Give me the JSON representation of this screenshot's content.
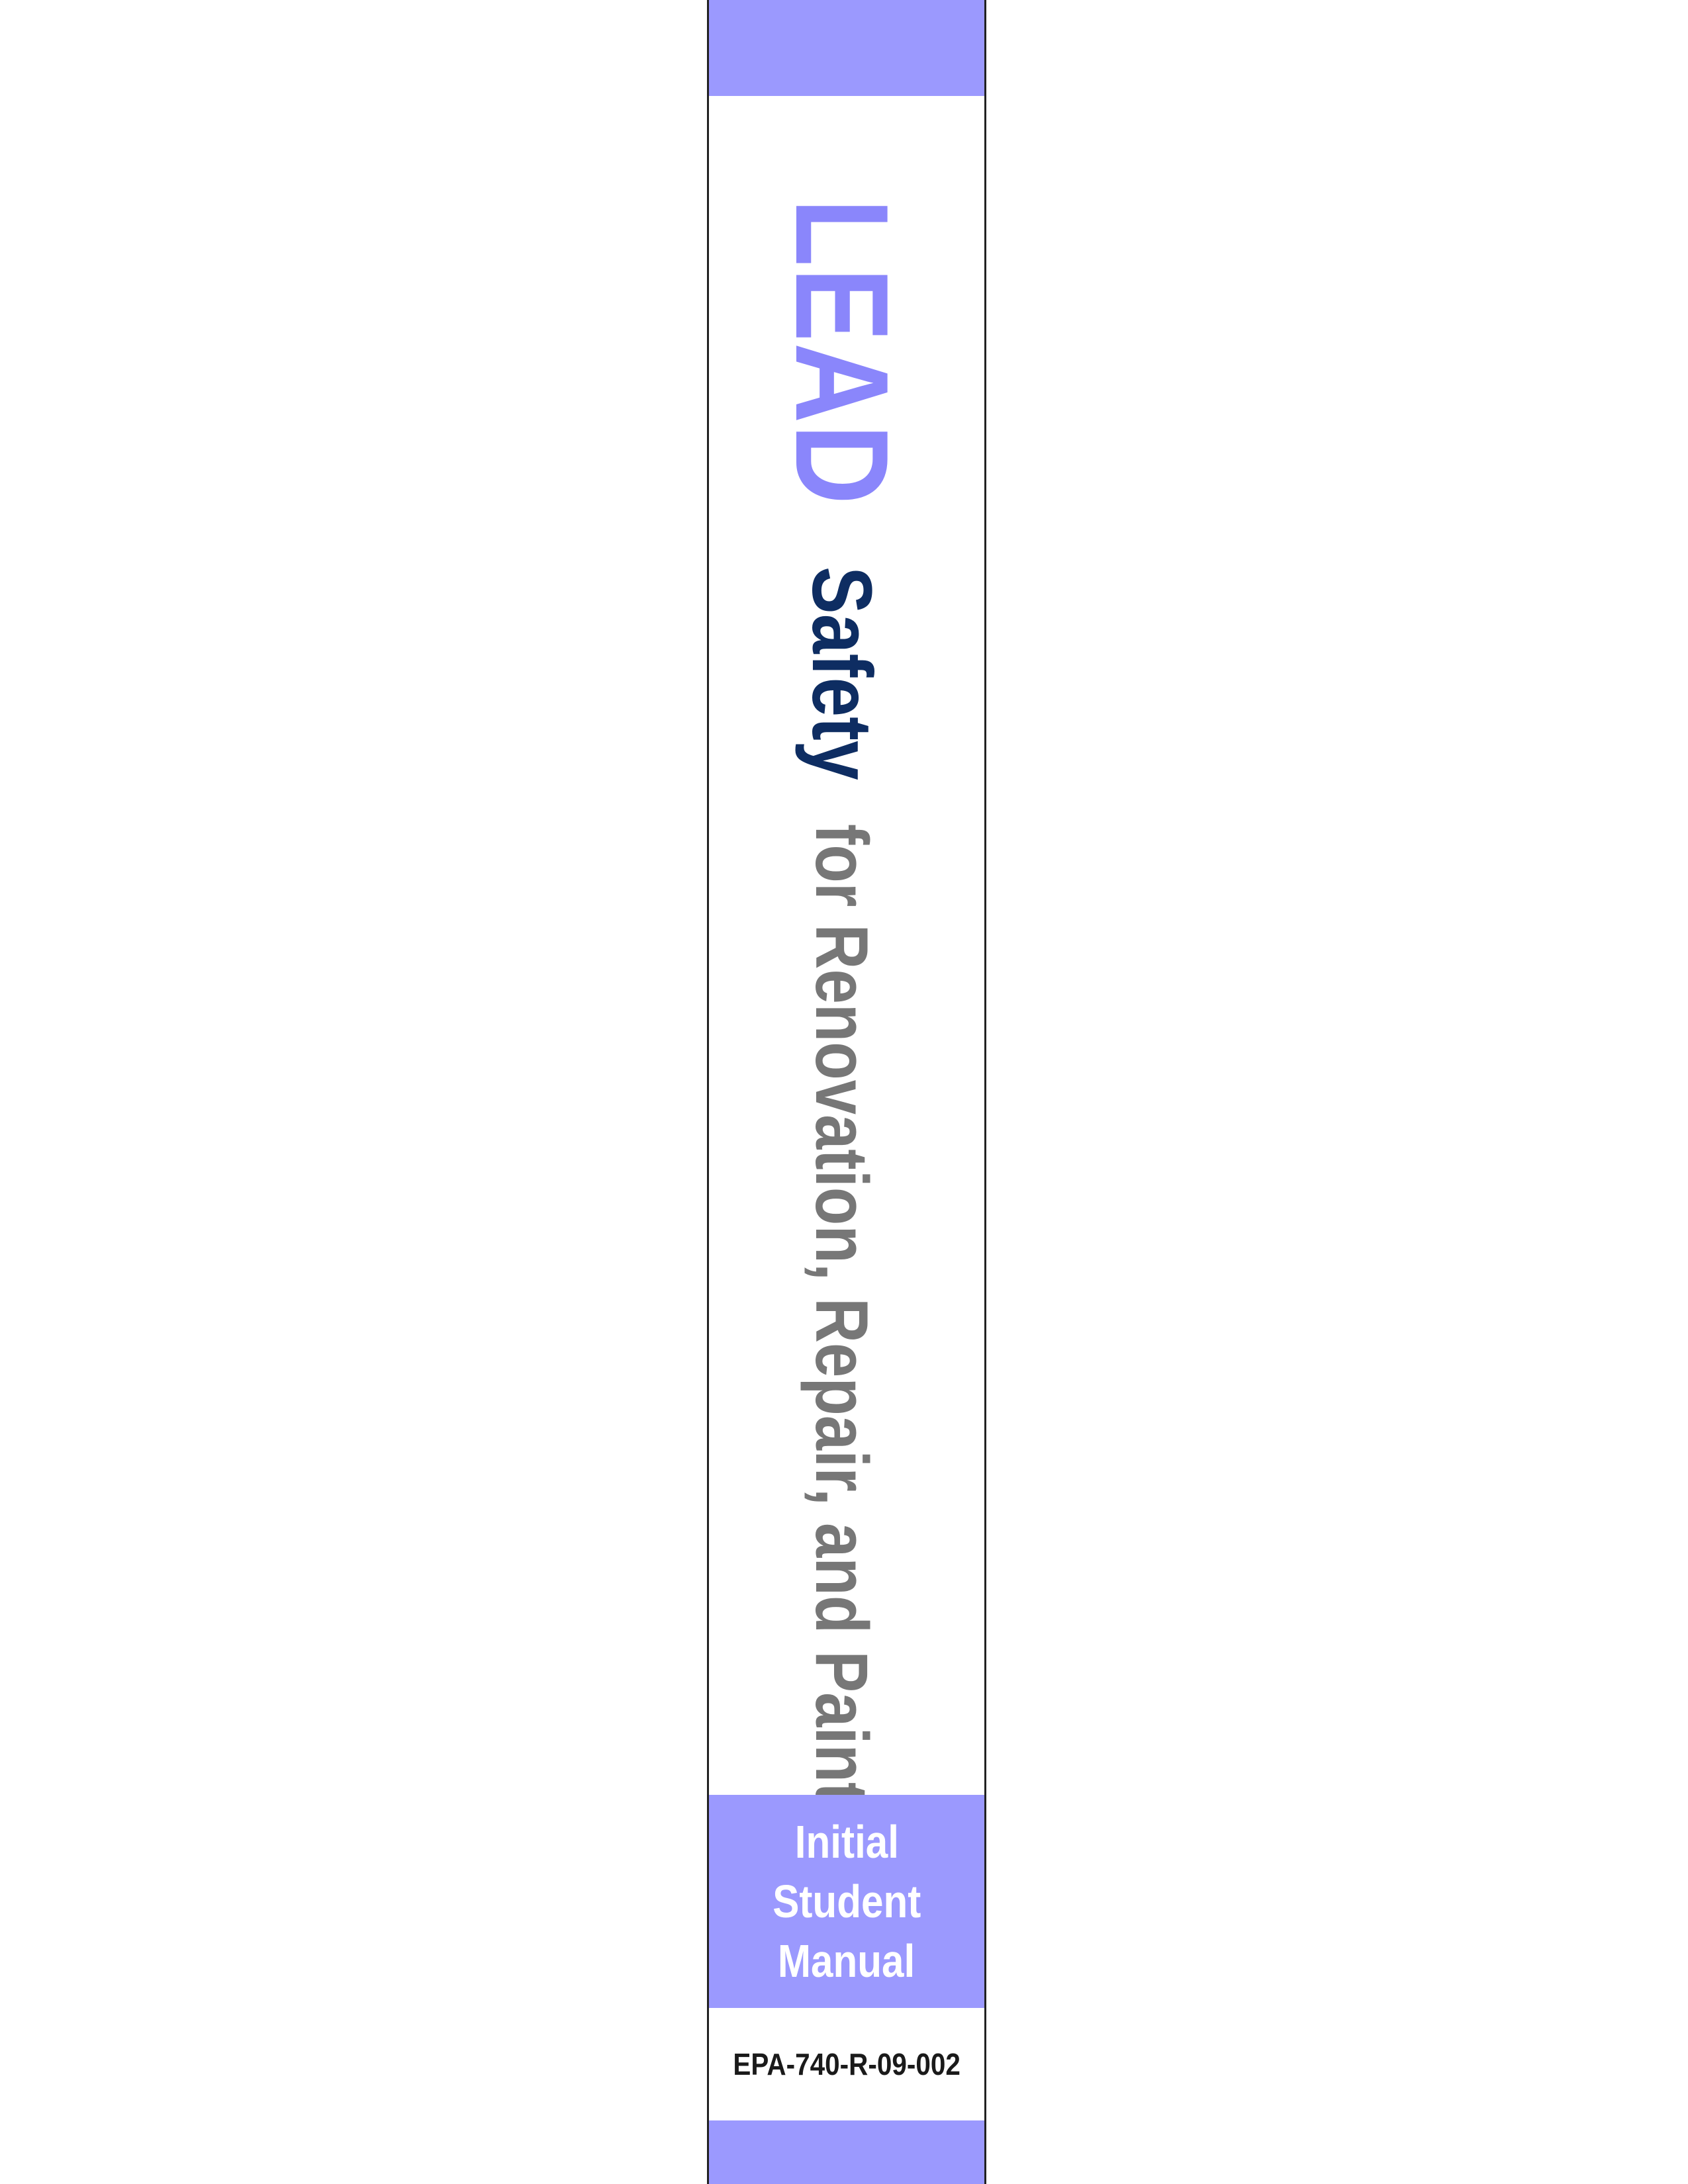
{
  "colors": {
    "band": "#9b99fe",
    "lead": "#8a86fb",
    "safety": "#0e2d62",
    "rest": "#777777"
  },
  "spine": {
    "title": {
      "lead": "LEAD",
      "safety": "Safety",
      "rest": "for Renovation, Repair, and Painting"
    },
    "manual_label": [
      "Initial",
      "Student",
      "Manual"
    ],
    "doc_number": "EPA-740-R-09-002"
  }
}
